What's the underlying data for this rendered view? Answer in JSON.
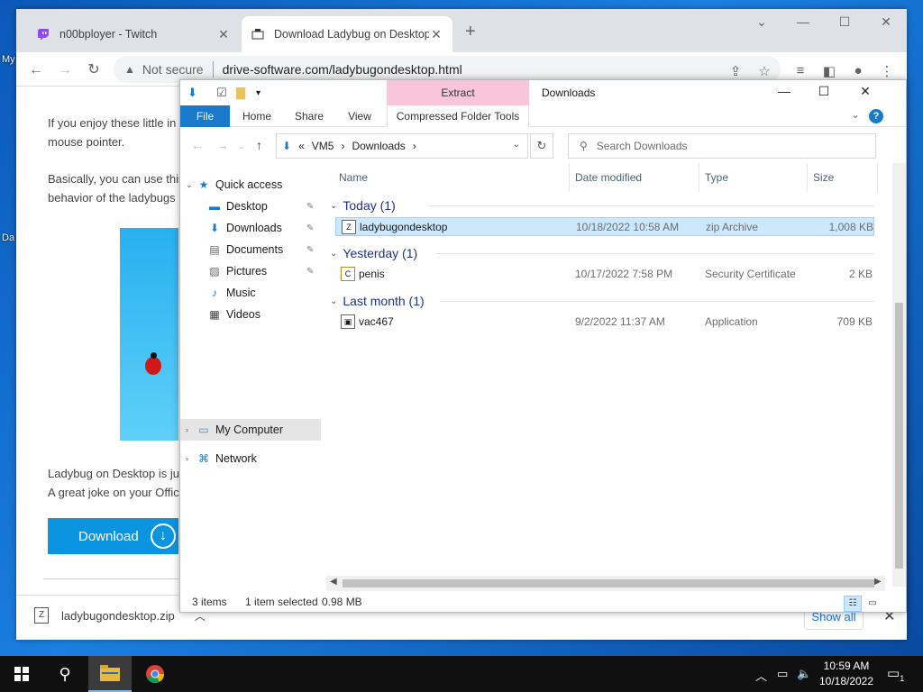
{
  "desktop": {
    "label_top": "My",
    "label_mid": "Da"
  },
  "browser": {
    "tabs": [
      {
        "label": "n00bployer - Twitch",
        "icon": "twitch-icon"
      },
      {
        "label": "Download Ladybug on Desktop f",
        "icon": "site-icon"
      }
    ],
    "not_secure": "Not secure",
    "url": "drive-software.com/ladybugondesktop.html"
  },
  "page": {
    "p1_line1": "If you enjoy these little in",
    "p1_line2": "mouse pointer.",
    "p2_line1": "Basically, you can use this",
    "p2_line2": "behavior of the ladybugs",
    "p3_line1": "Ladybug on Desktop is ju",
    "p3_line2": "A great joke on your Offic",
    "download_label": "Download"
  },
  "download_bar": {
    "filename": "ladybugondesktop.zip",
    "show_all": "Show all"
  },
  "explorer": {
    "context_tab": "Extract",
    "window_title": "Downloads",
    "ribbon": {
      "file": "File",
      "home": "Home",
      "share": "Share",
      "view": "View",
      "tools": "Compressed Folder Tools"
    },
    "address": {
      "overflow": "«",
      "c1": "VM5",
      "c2": "Downloads"
    },
    "search_placeholder": "Search Downloads",
    "nav": {
      "quick_access": "Quick access",
      "desktop": "Desktop",
      "downloads": "Downloads",
      "documents": "Documents",
      "pictures": "Pictures",
      "music": "Music",
      "videos": "Videos",
      "my_computer": "My Computer",
      "network": "Network"
    },
    "columns": {
      "name": "Name",
      "date": "Date modified",
      "type": "Type",
      "size": "Size"
    },
    "groups": [
      {
        "label": "Today (1)",
        "file": {
          "name": "ladybugondesktop",
          "date": "10/18/2022 10:58 AM",
          "type": "zip Archive",
          "size": "1,008 KB"
        }
      },
      {
        "label": "Yesterday (1)",
        "file": {
          "name": "penis",
          "date": "10/17/2022 7:58 PM",
          "type": "Security Certificate",
          "size": "2 KB"
        }
      },
      {
        "label": "Last month (1)",
        "file": {
          "name": "vac467",
          "date": "9/2/2022 11:37 AM",
          "type": "Application",
          "size": "709 KB"
        }
      }
    ],
    "status": {
      "items": "3 items",
      "selected": "1 item selected",
      "size": "0.98 MB"
    }
  },
  "taskbar": {
    "time": "10:59 AM",
    "date": "10/18/2022",
    "notif_count": "1"
  }
}
